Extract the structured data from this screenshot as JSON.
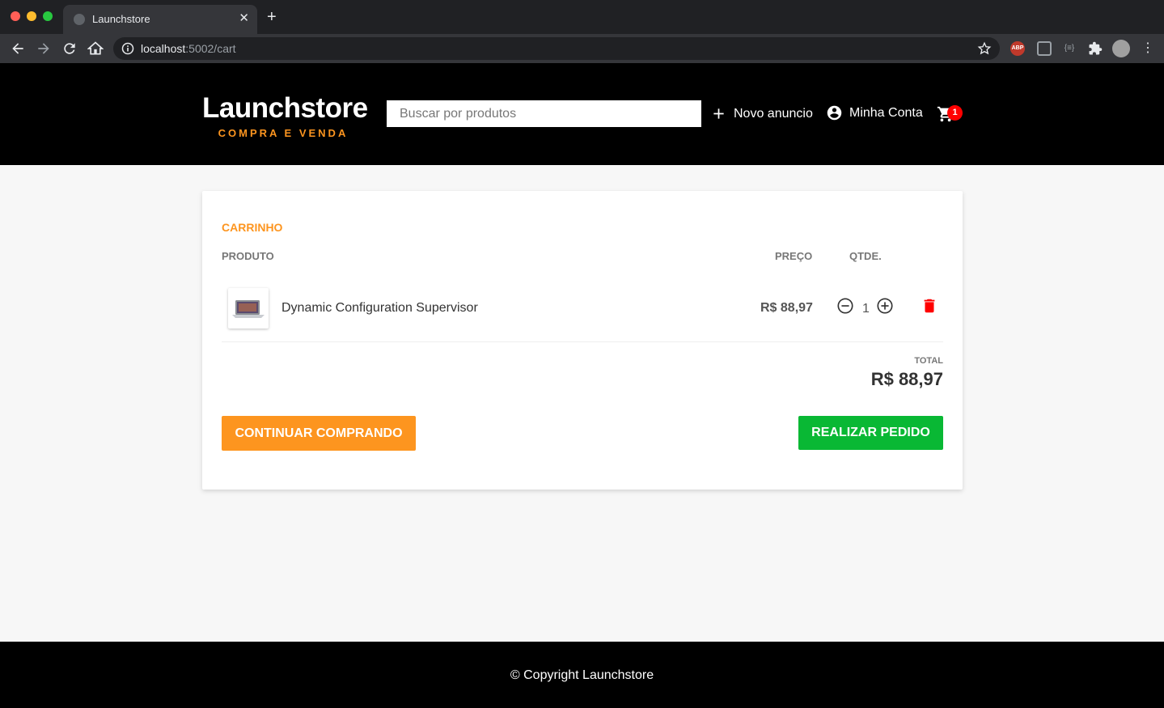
{
  "browser": {
    "tab_title": "Launchstore",
    "close_glyph": "✕",
    "new_tab_glyph": "+",
    "url_host": "localhost",
    "url_path": ":5002/cart",
    "abp_label": "ABP",
    "ext3_label": "{≡}",
    "menu_glyph": "⋮"
  },
  "header": {
    "logo_title": "Launchstore",
    "logo_subtitle": "COMPRA E VENDA",
    "search_placeholder": "Buscar por produtos",
    "new_ad_label": "Novo anuncio",
    "account_label": "Minha Conta",
    "cart_count": "1"
  },
  "cart": {
    "title": "CARRINHO",
    "columns": {
      "product": "PRODUTO",
      "price": "PREÇO",
      "qty": "QTDE."
    },
    "items": [
      {
        "name": "Dynamic Configuration Supervisor",
        "price": "R$ 88,97",
        "qty": "1"
      }
    ],
    "total_label": "TOTAL",
    "total_value": "R$ 88,97",
    "continue_label": "CONTINUAR COMPRANDO",
    "order_label": "REALIZAR PEDIDO"
  },
  "footer": {
    "text": "© Copyright Launchstore"
  },
  "colors": {
    "accent": "#fd951f",
    "success": "#09b834",
    "danger": "#ff0000"
  }
}
